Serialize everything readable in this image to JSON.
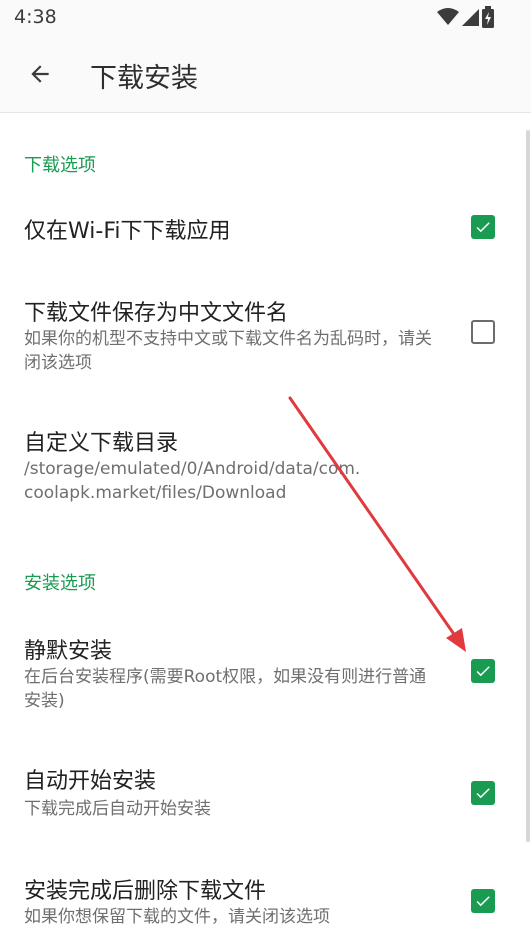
{
  "status_bar": {
    "time": "4:38",
    "icons": [
      "wifi-icon",
      "signal-icon",
      "battery-charging-icon"
    ]
  },
  "toolbar": {
    "back_icon": "arrow-left-icon",
    "title": "下载安装"
  },
  "sections": [
    {
      "header": "下载选项",
      "items": [
        {
          "title": "仅在Wi-Fi下下载应用",
          "summary": "",
          "checked": true
        },
        {
          "title": "下载文件保存为中文文件名",
          "summary": "如果你的机型不支持中文或下载文件名为乱码时，请关闭该选项",
          "checked": false
        },
        {
          "title": "自定义下载目录",
          "summary": "/storage/emulated/0/Android/data/com.coolapk.market/files/Download"
        }
      ]
    },
    {
      "header": "安装选项",
      "items": [
        {
          "title": "静默安装",
          "summary": "在后台安装程序(需要Root权限，如果没有则进行普通安装)",
          "checked": true
        },
        {
          "title": "自动开始安装",
          "summary": "下载完成后自动开始安装",
          "checked": true
        },
        {
          "title": "安装完成后删除下载文件",
          "summary": "如果你想保留下载的文件，请关闭该选项",
          "checked": true
        }
      ]
    }
  ],
  "colors": {
    "accent": "#1a9b52",
    "annotation_arrow": "#e0393e"
  }
}
